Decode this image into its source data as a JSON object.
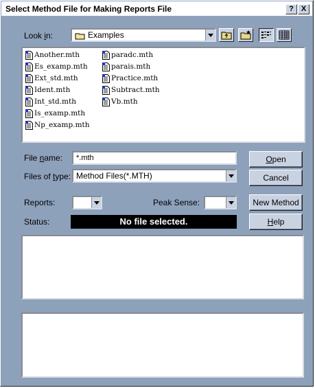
{
  "window": {
    "title": "Select Method File for Making Reports File",
    "help_glyph": "?",
    "close_glyph": "X"
  },
  "lookin": {
    "label_pre": "Look ",
    "label_u": "i",
    "label_post": "n:",
    "value": "Examples"
  },
  "files": [
    "Another.mth",
    "Es_examp.mth",
    "Ext_std.mth",
    "Ident.mth",
    "Int_std.mth",
    "Is_examp.mth",
    "Np_examp.mth",
    "paradc.mth",
    "parais.mth",
    "Practice.mth",
    "Subtract.mth",
    "Vb.mth"
  ],
  "filename": {
    "label_pre": "File ",
    "label_u": "n",
    "label_post": "ame:",
    "value": "*.mth"
  },
  "filetype": {
    "label_pre": "Files of ",
    "label_u": "t",
    "label_post": "ype:",
    "value": "Method Files(*.MTH)"
  },
  "buttons": {
    "open_u": "O",
    "open_rest": "pen",
    "cancel": "Cancel",
    "new_method": "New Method",
    "help_u": "H",
    "help_rest": "elp"
  },
  "reports": {
    "label": "Reports:",
    "value": ""
  },
  "peak": {
    "label": "Peak Sense:",
    "value": ""
  },
  "status": {
    "label": "Status:",
    "text": "No file selected."
  }
}
